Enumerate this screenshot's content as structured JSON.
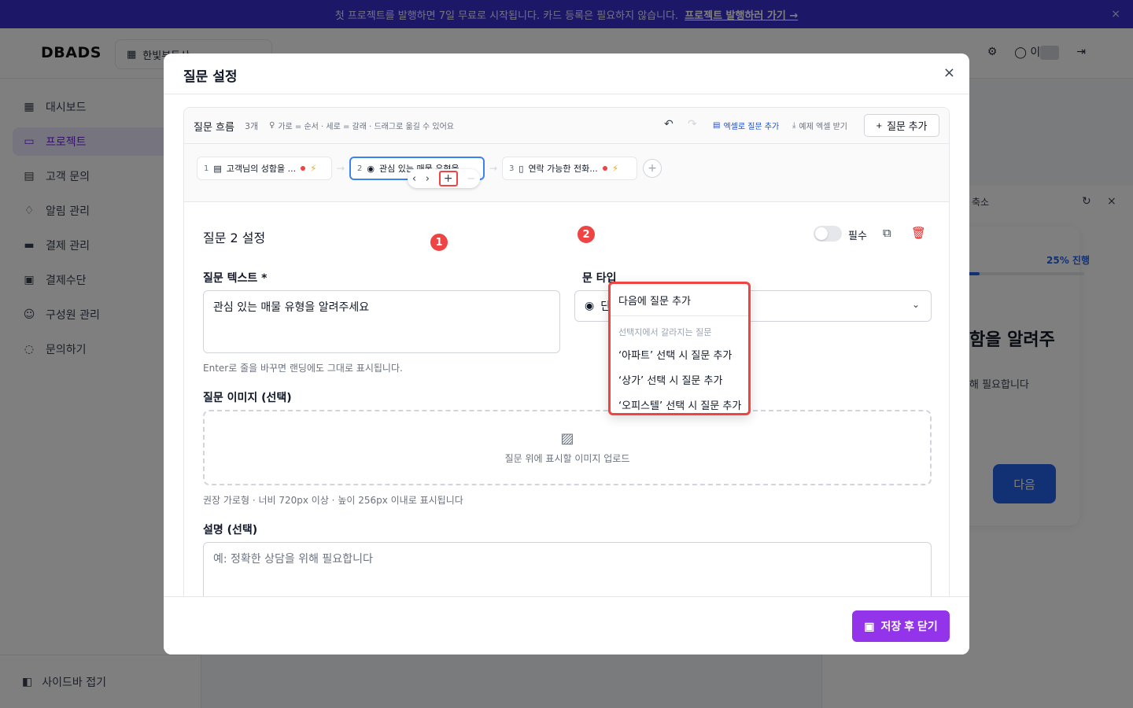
{
  "banner": {
    "text": "첫 프로젝트를 발행하면 7일 무료로 시작됩니다. 카드 등록은 필요하지 않습니다.",
    "link": "프로젝트 발행하러 가기 →",
    "close": "×"
  },
  "topbar": {
    "logo": "DBADS",
    "org": "한빛부동산",
    "user_initial": "이"
  },
  "sidebar": {
    "items": [
      {
        "label": "대시보드"
      },
      {
        "label": "프로젝트"
      },
      {
        "label": "고객 문의"
      },
      {
        "label": "알림 관리"
      },
      {
        "label": "결제 관리"
      },
      {
        "label": "결제수단"
      },
      {
        "label": "구성원 관리"
      },
      {
        "label": "문의하기"
      }
    ],
    "collapse_label": "사이드바 접기"
  },
  "preview": {
    "shrink": "축소",
    "progress_text": "25% 진행",
    "progress": 0.25,
    "question_partial": "함을 알려주",
    "desc_partial": "해 필요합니다",
    "next_button": "다음"
  },
  "modal": {
    "title": "질문 설정",
    "close": "×",
    "save_button": "저장 후 닫기"
  },
  "flow": {
    "title": "질문 흐름",
    "count": "3개",
    "hint": "가로 = 순서 · 세로 = 갈래 · 드래그로 옮길 수 있어요",
    "excel_add": "엑셀로 질문 추가",
    "sample_download": "예제 엑셀 받기",
    "add_question": "질문 추가",
    "nodes": [
      {
        "num": "1",
        "label": "고객님의 성함을 ..."
      },
      {
        "num": "2",
        "label": "관심 있는 매물 유형을 ..."
      },
      {
        "num": "3",
        "label": "연락 가능한 전화..."
      }
    ]
  },
  "badges": {
    "one": "1",
    "two": "2"
  },
  "menu": {
    "add_next": "다음에 질문 추가",
    "group_label": "선택지에서 갈라지는 질문",
    "options": [
      "‘아파트’ 선택 시 질문 추가",
      "‘상가’ 선택 시 질문 추가",
      "‘오피스텔’ 선택 시 질문 추가"
    ]
  },
  "settings": {
    "title": "질문 2 설정",
    "required_label": "필수",
    "text_label": "질문 텍스트 *",
    "text_value": "관심 있는 매물 유형을 알려주세요",
    "text_help": "Enter로 줄을 바꾸면 랜딩에도 그대로 표시됩니다.",
    "type_label": "문 타입",
    "type_value": "단일 선택",
    "image_label": "질문 이미지 (선택)",
    "image_upload": "질문 위에 표시할 이미지 업로드",
    "image_help": "권장 가로형 · 너비 720px 이상 · 높이 256px 이내로 표시됩니다",
    "desc_label": "설명 (선택)",
    "desc_placeholder": "예: 정확한 상담을 위해 필요합니다"
  },
  "colors": {
    "banner": "#3b2fd0",
    "accent": "#9333ea",
    "highlight": "#ef4444",
    "selected": "#3b82f6"
  }
}
